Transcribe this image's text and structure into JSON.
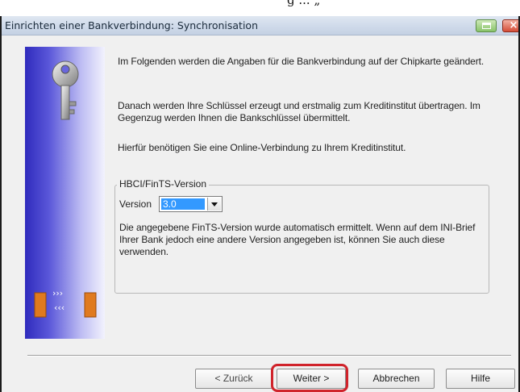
{
  "top_strip": {
    "cut_text": "g ... „"
  },
  "window": {
    "title": "Einrichten einer Bankverbindung: Synchronisation",
    "titlebar_icons": [
      "restore-icon",
      "close-icon"
    ]
  },
  "content": {
    "paragraphs": [
      "Im Folgenden werden die Angaben für die Bankverbindung auf der Chipkarte geändert.",
      "Danach werden Ihre Schlüssel erzeugt und erstmalig zum Kreditinstitut übertragen. Im Gegenzug werden Ihnen die Bankschlüssel übermittelt.",
      "Hierfür benötigen Sie eine Online-Verbindung zu Ihrem Kreditinstitut."
    ],
    "group": {
      "title": "HBCI/FinTS-Version",
      "version_label": "Version",
      "version_value": "3.0",
      "description": "Die angegebene FinTS-Version wurde automatisch ermittelt. Wenn auf dem INI-Brief Ihrer Bank jedoch eine andere Version angegeben ist, können Sie auch diese verwenden."
    }
  },
  "buttons": {
    "back": "< Zurück",
    "next": "Weiter >",
    "cancel": "Abbrechen",
    "help": "Hilfe"
  },
  "colors": {
    "highlight": "#d0232b",
    "selection": "#3399ff"
  }
}
